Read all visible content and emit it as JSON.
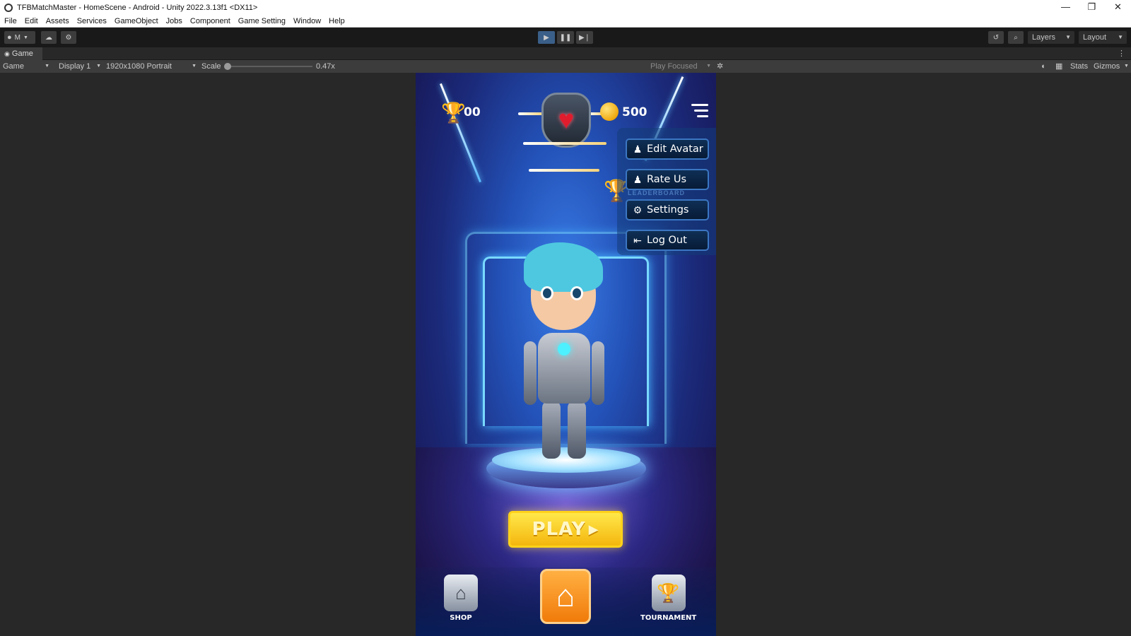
{
  "window": {
    "title": "TFBMatchMaster - HomeScene - Android - Unity 2022.3.13f1 <DX11>",
    "controls": [
      "—",
      "❐",
      "✕"
    ]
  },
  "menubar": [
    "File",
    "Edit",
    "Assets",
    "Services",
    "GameObject",
    "Jobs",
    "Component",
    "Game Setting",
    "Window",
    "Help"
  ],
  "toolbar": {
    "account_label": "M",
    "layers_label": "Layers",
    "layout_label": "Layout",
    "icons": [
      "account-icon",
      "cloud-icon",
      "collab-icon",
      "play-icon",
      "pause-icon",
      "step-icon",
      "history-icon",
      "search-icon"
    ]
  },
  "game_tab": {
    "label": "Game"
  },
  "game_toolbar": {
    "view_mode": "Game",
    "display": "Display 1",
    "resolution": "1920x1080 Portrait",
    "scale_label": "Scale",
    "scale_value": "0.47x",
    "play_mode": "Play Focused",
    "stats_label": "Stats",
    "gizmos_label": "Gizmos"
  },
  "game": {
    "hud": {
      "trophies": "00",
      "coins": "500"
    },
    "menu": [
      {
        "label": "Edit Avatar",
        "icon": "person-icon"
      },
      {
        "label": "Rate Us",
        "icon": "person-icon"
      },
      {
        "label": "Settings",
        "icon": "gear-icon"
      },
      {
        "label": "Log Out",
        "icon": "logout-icon"
      }
    ],
    "ghost_label": "LEADERBOARD",
    "play_label": "PLAY",
    "nav": {
      "shop": "SHOP",
      "tournament": "TOURNAMENT"
    }
  },
  "colors": {
    "editor_bg": "#282828",
    "play_button": "#f4b60e",
    "home_button": "#f07b0a",
    "menu_border": "#3b76c2"
  }
}
